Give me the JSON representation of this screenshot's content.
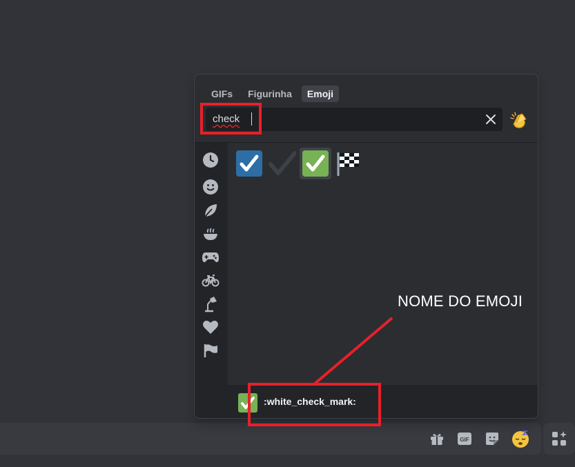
{
  "picker": {
    "tabs": [
      {
        "label": "GIFs",
        "active": false
      },
      {
        "label": "Figurinha",
        "active": false
      },
      {
        "label": "Emoji",
        "active": true
      }
    ],
    "search": {
      "value": "check"
    },
    "skin_tone_icon": "clapping-hands-icon",
    "categories": [
      "recent-clock-icon",
      "smiley-icon",
      "leaf-icon",
      "food-bowl-icon",
      "game-controller-icon",
      "bicycle-icon",
      "lamp-icon",
      "heart-icon",
      "flag-icon"
    ],
    "results": [
      {
        "icon": "ballot-box-with-check",
        "glyph": "☑"
      },
      {
        "icon": "heavy-check-mark",
        "glyph": "✔"
      },
      {
        "icon": "white-check-mark",
        "glyph": "✅"
      },
      {
        "icon": "chequered-flag",
        "glyph": "🏁"
      }
    ],
    "footer": {
      "name": ":white_check_mark:"
    }
  },
  "chat_bar": {
    "icons": [
      "gift-icon",
      "gif-icon",
      "sticker-icon",
      "emoji-sleepy-face-icon",
      "apps-icon"
    ],
    "gif_label": "GIF"
  },
  "annotation": {
    "label": "NOME DO EMOJI",
    "color": "#e8202a"
  },
  "colors": {
    "accent_green": "#77b255",
    "check_blue": "#2d6ea6",
    "background": "#313338"
  }
}
